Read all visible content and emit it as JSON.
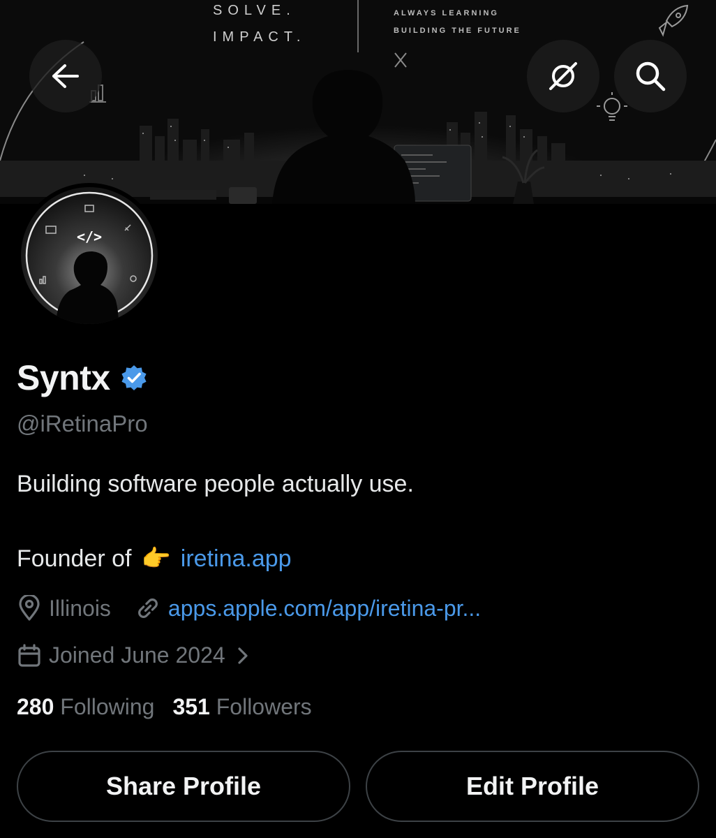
{
  "banner": {
    "line1": "SOLVE.",
    "line2": "IMPACT.",
    "tag1": "ALWAYS LEARNING",
    "tag2": "BUILDING THE FUTURE"
  },
  "header": {
    "back_icon": "arrow-left-icon",
    "grok_icon": "grok-slash-icon",
    "search_icon": "search-icon"
  },
  "profile": {
    "name": "Syntx",
    "verified": true,
    "verified_color": "#4a99e9",
    "handle": "@iRetinaPro",
    "bio_line1": "Building software people actually use.",
    "bio_line2_prefix": "Founder of",
    "bio_emoji": "👉",
    "bio_link": "iretina.app",
    "location": "Illinois",
    "website": "apps.apple.com/app/iretina-pr...",
    "joined": "Joined June 2024",
    "following_count": "280",
    "following_label": "Following",
    "followers_count": "351",
    "followers_label": "Followers"
  },
  "actions": {
    "share_label": "Share Profile",
    "edit_label": "Edit Profile"
  },
  "colors": {
    "background": "#000000",
    "muted_text": "#71767b",
    "link": "#4a99e9",
    "border": "#3d4246"
  }
}
